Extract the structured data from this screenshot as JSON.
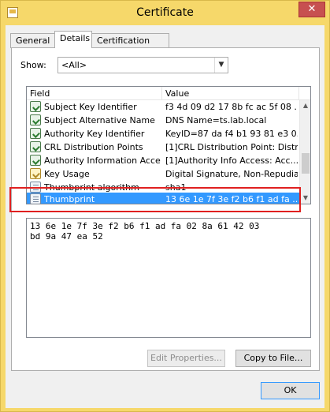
{
  "window": {
    "title": "Certificate",
    "close_label": "✕"
  },
  "tabs": [
    {
      "label": "General"
    },
    {
      "label": "Details"
    },
    {
      "label": "Certification Path"
    }
  ],
  "details": {
    "show_label": "Show:",
    "show_value": "<All>",
    "columns": {
      "field": "Field",
      "value": "Value"
    },
    "rows": [
      {
        "field": "Subject Key Identifier",
        "value": "f3 4d 09 d2 17 8b fc ac 5f 08 ..."
      },
      {
        "field": "Subject Alternative Name",
        "value": "DNS Name=ts.lab.local"
      },
      {
        "field": "Authority Key Identifier",
        "value": "KeyID=87 da f4 b1 93 81 e3 0..."
      },
      {
        "field": "CRL Distribution Points",
        "value": "[1]CRL Distribution Point: Distr..."
      },
      {
        "field": "Authority Information Access",
        "value": "[1]Authority Info Access: Acc..."
      },
      {
        "field": "Key Usage",
        "value": "Digital Signature, Non-Repudia..."
      },
      {
        "field": "Thumbprint algorithm",
        "value": "sha1"
      },
      {
        "field": "Thumbprint",
        "value": "13 6e 1e 7f 3e f2 b6 f1 ad fa ..."
      }
    ],
    "value_lines": [
      "13 6e 1e 7f 3e f2 b6 f1 ad fa 02 8a 61 42 03",
      "bd 9a 47 ea 52"
    ],
    "edit_properties_label": "Edit Properties...",
    "copy_to_file_label": "Copy to File..."
  },
  "footer": {
    "ok_label": "OK"
  }
}
